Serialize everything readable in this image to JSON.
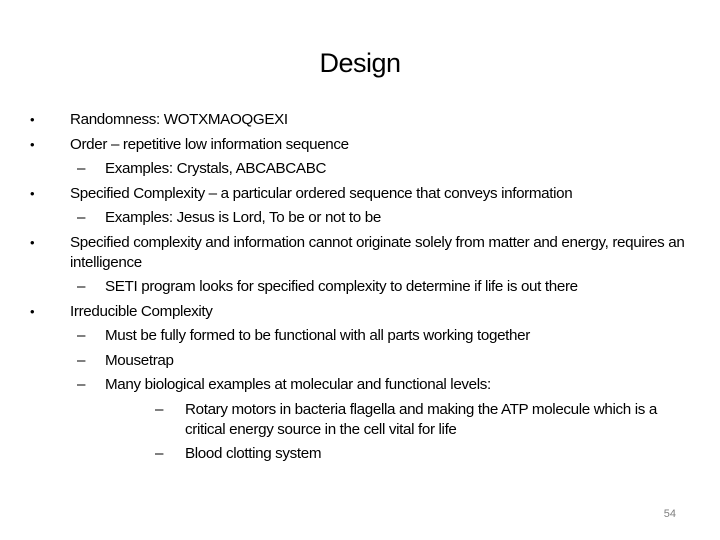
{
  "slide": {
    "title": "Design",
    "page_number": "54",
    "bullet_glyph": "•",
    "dash_glyph": "–",
    "items": [
      {
        "level": 1,
        "text": "Randomness:   WOTXMAOQGEXI"
      },
      {
        "level": 1,
        "text": "Order – repetitive low information sequence"
      },
      {
        "level": 2,
        "text": "Examples:  Crystals, ABCABCABC"
      },
      {
        "level": 1,
        "text": "Specified Complexity – a particular ordered sequence that conveys information"
      },
      {
        "level": 2,
        "text": "Examples:  Jesus is Lord, To be or not to be"
      },
      {
        "level": 1,
        "text": "Specified complexity and information cannot originate solely from matter and energy, requires an intelligence"
      },
      {
        "level": 2,
        "text": "SETI program looks for specified complexity to determine if life is out there"
      },
      {
        "level": 1,
        "text": "Irreducible Complexity"
      },
      {
        "level": 2,
        "text": "Must be fully formed to be functional with all parts working together"
      },
      {
        "level": 2,
        "text": "Mousetrap"
      },
      {
        "level": 2,
        "text": "Many biological examples at molecular and functional levels:"
      },
      {
        "level": 3,
        "text": "Rotary motors in bacteria flagella and making the ATP molecule which is a critical energy source in the cell vital for life"
      },
      {
        "level": 3,
        "text": "Blood clotting system"
      }
    ]
  }
}
